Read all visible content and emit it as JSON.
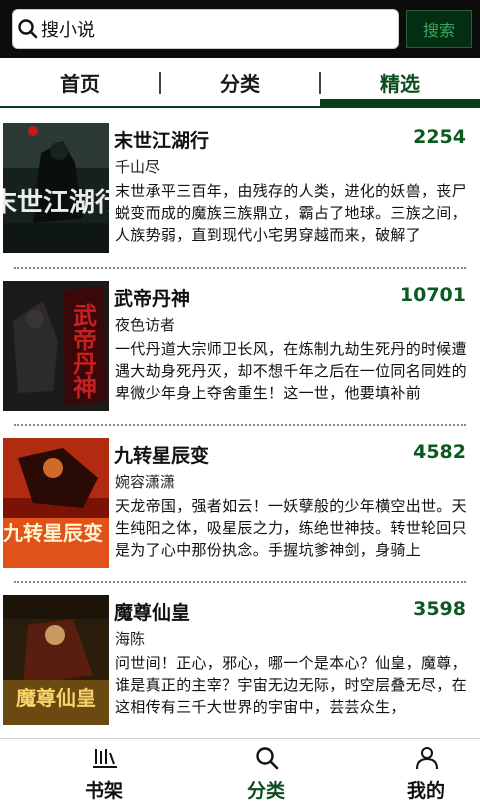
{
  "search": {
    "placeholder": "搜小说",
    "button_label": "搜索"
  },
  "tabs": [
    {
      "label": "首页",
      "active": false
    },
    {
      "label": "分类",
      "active": false
    },
    {
      "label": "精选",
      "active": true
    }
  ],
  "books": [
    {
      "title": "末世江湖行",
      "count": "2254",
      "author": "千山尽",
      "description": "末世承平三百年，由残存的人类，进化的妖兽，丧尸蜕变而成的魔族三族鼎立，霸占了地球。三族之间，人族势弱，直到现代小宅男穿越而来，破解了",
      "cover_text": "末世江湖行"
    },
    {
      "title": "武帝丹神",
      "count": "10701",
      "author": "夜色访者",
      "description": "一代丹道大宗师卫长风，在炼制九劫生死丹的时候遭遇大劫身死丹灭，却不想千年之后在一位同名同姓的卑微少年身上夺舍重生！这一世，他要填补前",
      "cover_text": "武帝丹神"
    },
    {
      "title": "九转星辰变",
      "count": "4582",
      "author": "婉容潇潇",
      "description": "天龙帝国，强者如云！一妖孽般的少年横空出世。天生纯阳之体，吸星辰之力，练绝世神技。转世轮回只是为了心中那份执念。手握坑爹神剑，身骑上",
      "cover_text": "九转星辰变"
    },
    {
      "title": "魔尊仙皇",
      "count": "3598",
      "author": "海陈",
      "description": "问世间！正心，邪心，哪一个是本心？仙皇，魔尊，谁是真正的主宰？宇宙无边无际，时空层叠无尽，在这相传有三千大世界的宇宙中，芸芸众生，",
      "cover_text": "魔尊仙皇"
    }
  ],
  "nav": [
    {
      "label": "书架",
      "icon": "bookshelf-icon",
      "active": false
    },
    {
      "label": "分类",
      "icon": "search-icon",
      "active": true
    },
    {
      "label": "我的",
      "icon": "user-icon",
      "active": false
    }
  ],
  "colors": {
    "accent": "#0b4d1e",
    "count": "#0b5a22",
    "topbar": "#0c0c0c"
  }
}
